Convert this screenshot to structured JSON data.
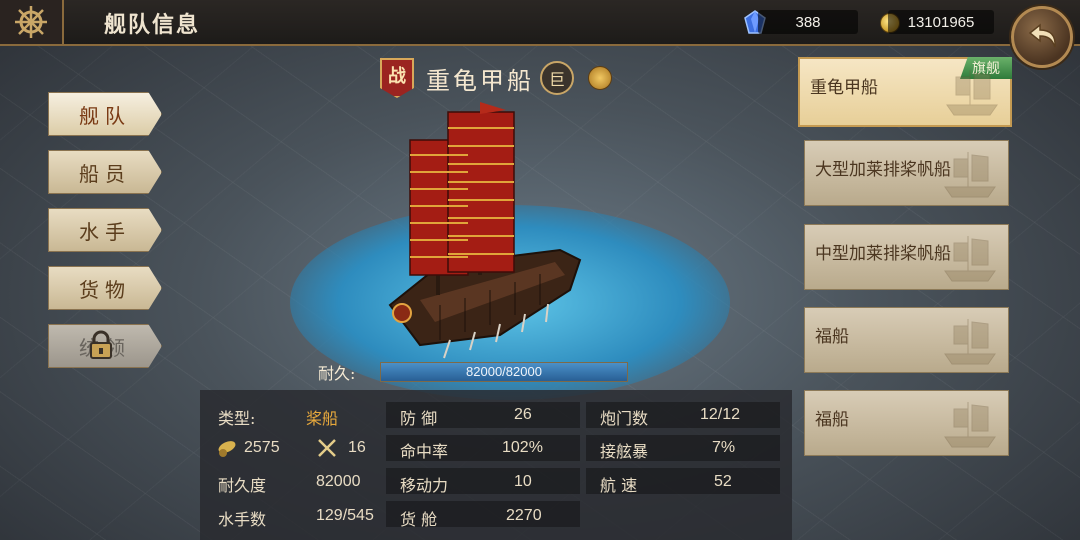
{
  "header": {
    "title": "舰队信息",
    "gems": "388",
    "gold": "13101965"
  },
  "menu": [
    {
      "label": "舰队",
      "active": true
    },
    {
      "label": "船员"
    },
    {
      "label": "水手"
    },
    {
      "label": "货物"
    },
    {
      "label": "统领",
      "locked": true
    }
  ],
  "ship": {
    "badge": "战",
    "name": "重龟甲船",
    "size": "巨",
    "durability_label": "耐久:",
    "durability_text": "82000/82000",
    "durability_current": 82000,
    "durability_max": 82000
  },
  "stats": {
    "type_label": "类型:",
    "type_value": "桨船",
    "cannon_value": "2575",
    "melee_value": "16",
    "durability_label": "耐久度",
    "durability_value": "82000",
    "sailors_label": "水手数",
    "sailors_value": "129/545",
    "defense_label": "防 御",
    "defense_value": "26",
    "accuracy_label": "命中率",
    "accuracy_value": "102%",
    "mobility_label": "移动力",
    "mobility_value": "10",
    "cargo_label": "货 舱",
    "cargo_value": "2270",
    "gunports_label": "炮门数",
    "gunports_value": "12/12",
    "boarding_label": "接舷暴",
    "boarding_value": "7%",
    "speed_label": "航 速",
    "speed_value": "52"
  },
  "fleet_list": [
    {
      "name": "重龟甲船",
      "tag": "旗舰",
      "selected": true
    },
    {
      "name": "大型加莱排桨帆船"
    },
    {
      "name": "中型加莱排桨帆船"
    },
    {
      "name": "福船"
    },
    {
      "name": "福船"
    }
  ],
  "colors": {
    "accent_gold": "#e6a83c",
    "war_red": "#9b2420",
    "durability_blue": "#285f95"
  },
  "icons": [
    "ship-wheel-icon",
    "gem-icon",
    "coin-icon",
    "back-arrow-icon",
    "lock-icon",
    "cannon-icon",
    "crossed-swords-icon",
    "switch-icon"
  ]
}
